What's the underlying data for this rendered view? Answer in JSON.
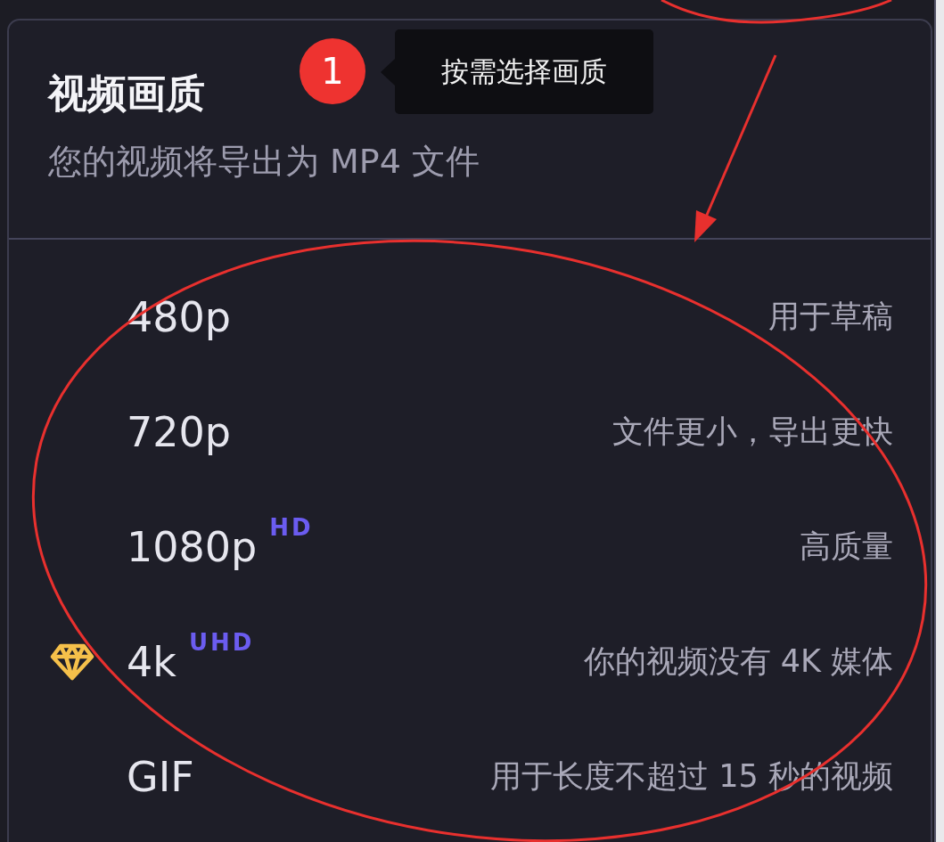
{
  "panel": {
    "title": "视频画质",
    "subtitle": "您的视频将导出为 MP4 文件"
  },
  "callout": {
    "number": "1",
    "tip": "按需选择画质"
  },
  "options": [
    {
      "label": "480p",
      "description": "用于草稿",
      "premium": false
    },
    {
      "label": "720p",
      "description": "文件更小，导出更快",
      "premium": false
    },
    {
      "label": "1080p",
      "badge": "HD",
      "description": "高质量",
      "premium": false
    },
    {
      "label": "4k",
      "badge": "UHD",
      "description": "你的视频没有 4K 媒体",
      "premium": true
    },
    {
      "label": "GIF",
      "description": "用于长度不超过 15 秒的视频",
      "premium": false
    }
  ]
}
